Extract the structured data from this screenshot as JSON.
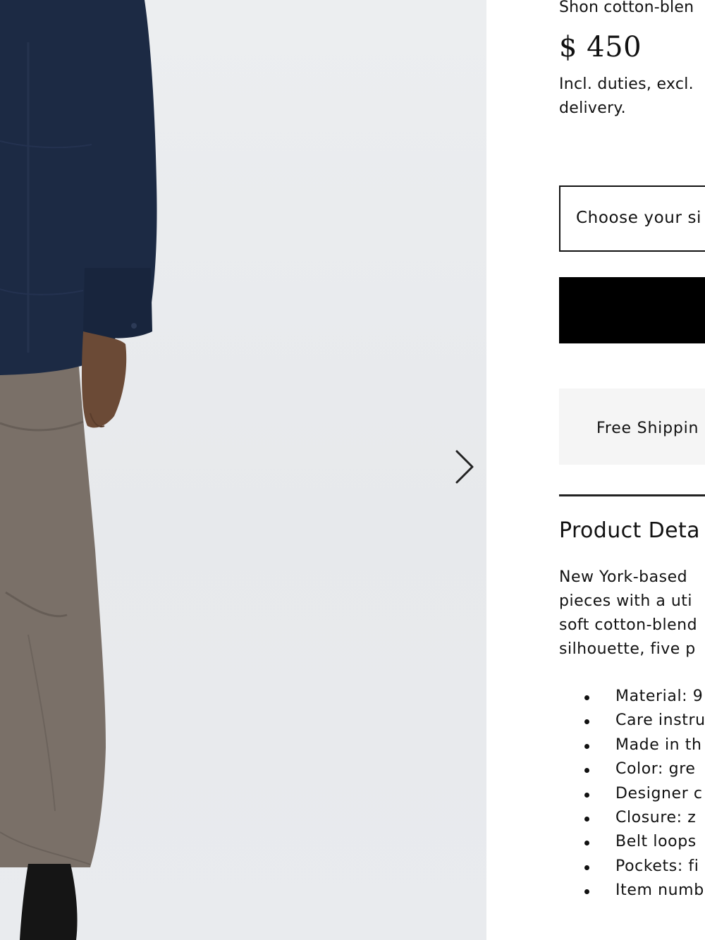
{
  "product": {
    "name": "Shon cotton-blen",
    "price": "$ 450",
    "tax_note": "Incl. duties, excl. delivery."
  },
  "actions": {
    "size_select_placeholder": "Choose your si",
    "add_button_label": ""
  },
  "shipping": {
    "label": "Free Shippin"
  },
  "details": {
    "heading": "Product Deta",
    "description_lines": [
      "New York-based",
      "pieces with a uti",
      "soft cotton-blend",
      "silhouette, five p"
    ],
    "items": [
      "Material: 9",
      "Care instru",
      "Made in th",
      "Color: gre",
      "Designer c",
      "Closure: z",
      "Belt loops",
      "Pockets: fi",
      "Item numb"
    ]
  },
  "icons": {
    "next_image": "chevron-right-icon",
    "bullet": "bullet-dot-icon"
  },
  "colors": {
    "image_background": "#eceef0",
    "jacket": "#1c2a44",
    "skirt": "#7a7068",
    "skin": "#6b4a36",
    "button": "#000000",
    "shipping_box": "#f5f5f5"
  }
}
